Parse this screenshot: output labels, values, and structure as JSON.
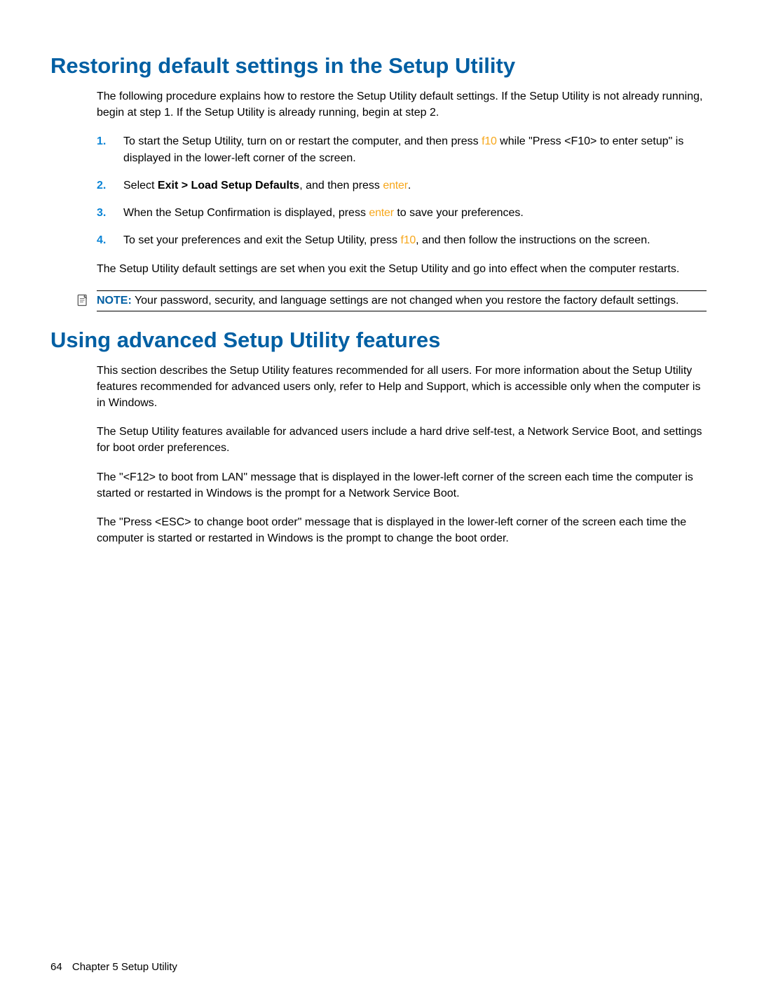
{
  "section1": {
    "heading": "Restoring default settings in the Setup Utility",
    "intro": "The following procedure explains how to restore the Setup Utility default settings. If the Setup Utility is not already running, begin at step 1. If the Setup Utility is already running, begin at step 2.",
    "steps": [
      {
        "n": "1.",
        "pre": "To start the Setup Utility, turn on or restart the computer, and then press ",
        "key": "f10",
        "post": " while \"Press <F10> to enter setup\" is displayed in the lower-left corner of the screen."
      },
      {
        "n": "2.",
        "pre": "Select ",
        "bold": "Exit > Load Setup Defaults",
        "mid": ", and then press ",
        "key": "enter",
        "post": "."
      },
      {
        "n": "3.",
        "pre": "When the Setup Confirmation is displayed, press ",
        "key": "enter",
        "post": " to save your preferences."
      },
      {
        "n": "4.",
        "pre": "To set your preferences and exit the Setup Utility, press ",
        "key": "f10",
        "post": ", and then follow the instructions on the screen."
      }
    ],
    "after": "The Setup Utility default settings are set when you exit the Setup Utility and go into effect when the computer restarts.",
    "note_label": "NOTE:",
    "note_text": "   Your password, security, and language settings are not changed when you restore the factory default settings."
  },
  "section2": {
    "heading": "Using advanced Setup Utility features",
    "p1": "This section describes the Setup Utility features recommended for all users. For more information about the Setup Utility features recommended for advanced users only, refer to Help and Support, which is accessible only when the computer is in Windows.",
    "p2": "The Setup Utility features available for advanced users include a hard drive self-test, a Network Service Boot, and settings for boot order preferences.",
    "p3": "The \"<F12> to boot from LAN\" message that is displayed in the lower-left corner of the screen each time the computer is started or restarted in Windows is the prompt for a Network Service Boot.",
    "p4": "The \"Press <ESC> to change boot order\" message that is displayed in the lower-left corner of the screen each time the computer is started or restarted in Windows is the prompt to change the boot order."
  },
  "footer": {
    "page": "64",
    "chapter": "Chapter 5   Setup Utility"
  }
}
